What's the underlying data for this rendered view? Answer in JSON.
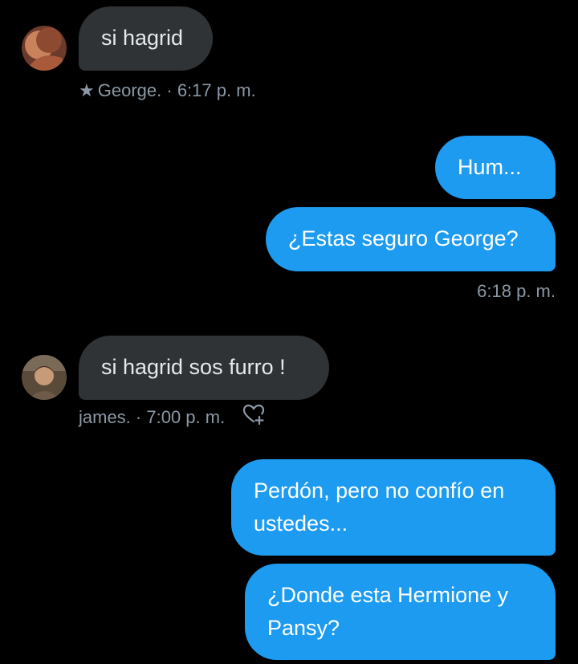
{
  "messages": [
    {
      "direction": "incoming",
      "text": "si hagrid",
      "meta": {
        "star": "★",
        "sender": "George.",
        "separator": "·",
        "time": "6:17 p. m."
      }
    },
    {
      "direction": "outgoing",
      "text": "Hum..."
    },
    {
      "direction": "outgoing",
      "text": "¿Estas seguro George?",
      "meta": {
        "time": "6:18 p. m."
      }
    },
    {
      "direction": "incoming",
      "text": "si hagrid sos furro !",
      "meta": {
        "sender": "james.",
        "separator": "·",
        "time": "7:00 p. m."
      }
    },
    {
      "direction": "outgoing",
      "text": "Perdón, pero no confío en\nustedes..."
    },
    {
      "direction": "outgoing",
      "text": "¿Donde esta Hermione y\nPansy?"
    }
  ],
  "icons": {
    "star": "star-icon",
    "like": "heart-plus-icon"
  },
  "colors": {
    "background": "#000000",
    "incoming_bubble": "#2f3336",
    "outgoing_bubble": "#1d9bf0",
    "meta_text": "#8b98a5"
  }
}
